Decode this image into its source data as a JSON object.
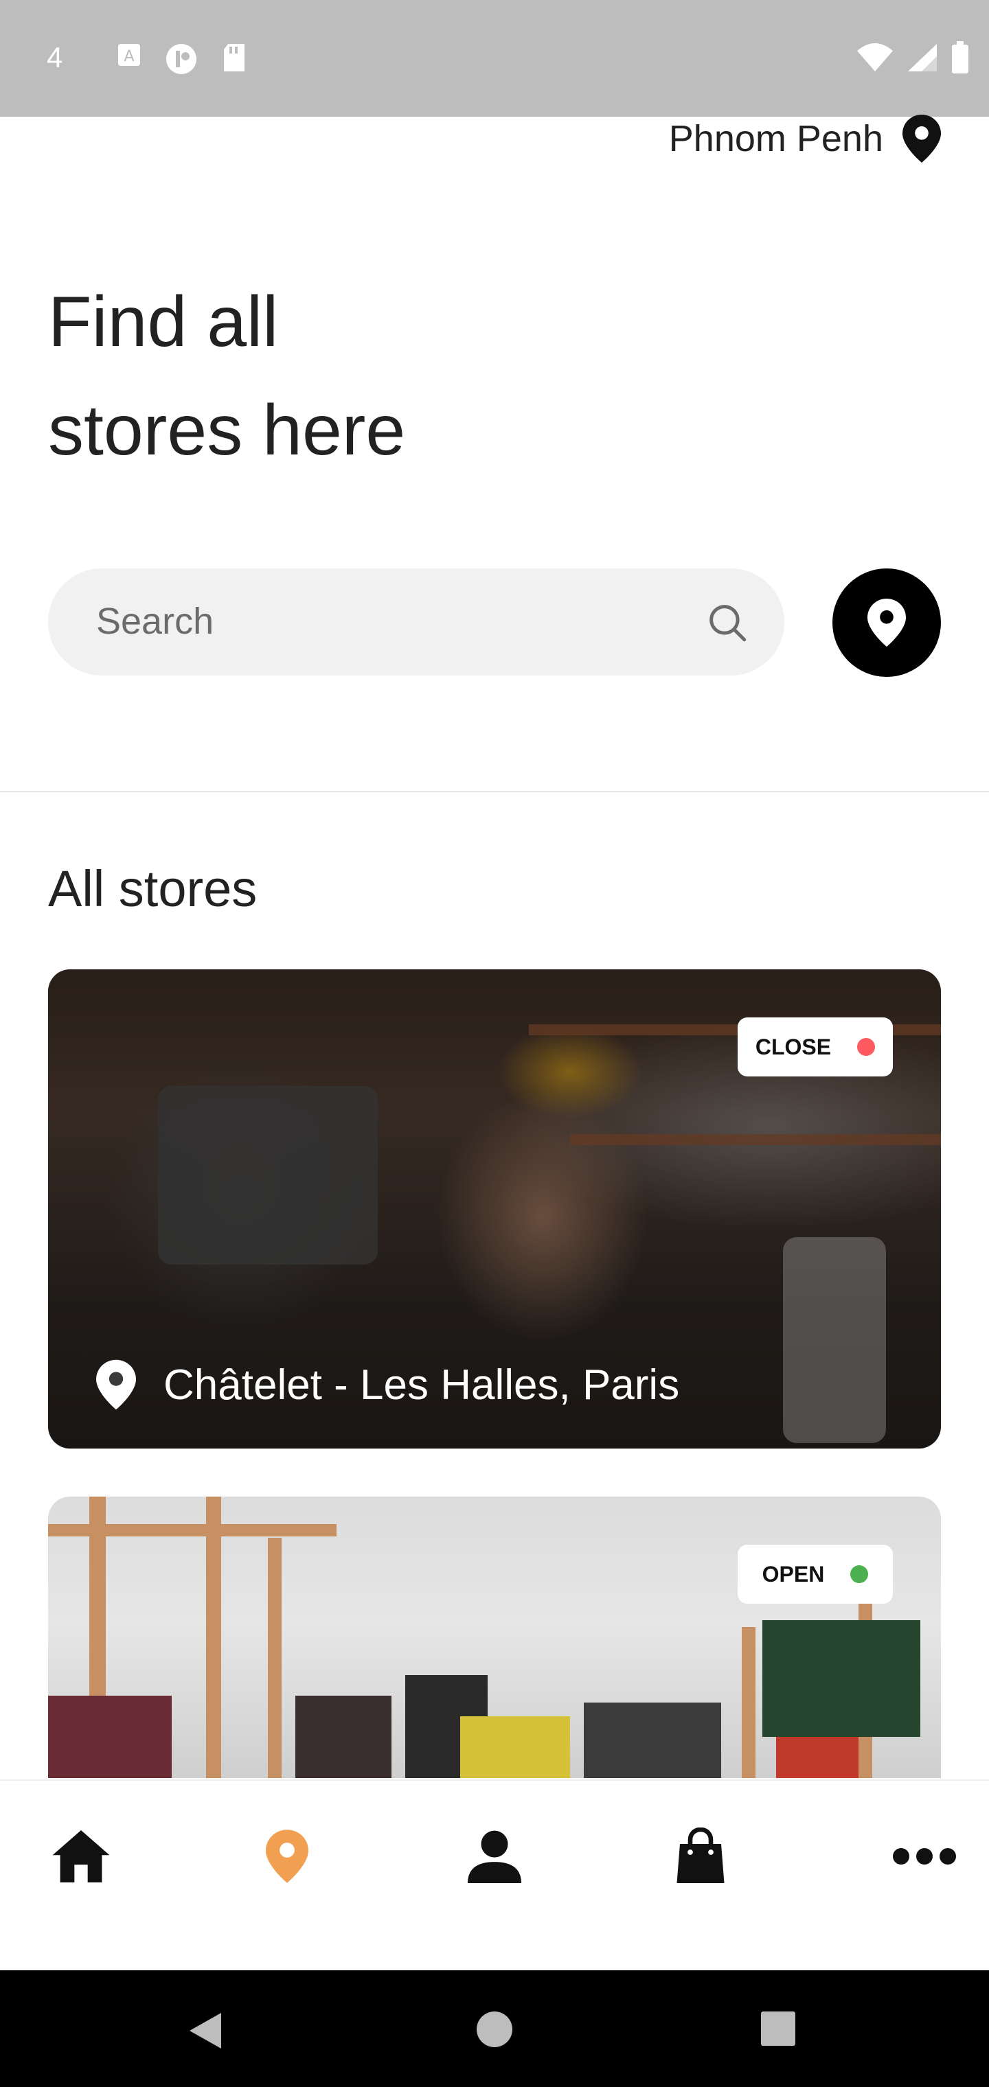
{
  "status_bar": {
    "time": "4",
    "icons": [
      "a-icon",
      "app-icon",
      "sd-card-icon",
      "wifi-icon",
      "signal-icon",
      "battery-icon"
    ]
  },
  "header": {
    "location_name": "Phnom Penh",
    "location_icon": "location-pin-icon"
  },
  "title": {
    "line1": "Find all",
    "line2": "stores here"
  },
  "search": {
    "placeholder": "Search"
  },
  "section_title": "All stores",
  "stores": [
    {
      "status": "CLOSE",
      "status_color": "#ff5a5f",
      "location": "Châtelet - Les Halles, Paris"
    },
    {
      "status": "OPEN",
      "status_color": "#4caf50",
      "location": ""
    }
  ],
  "bottom_nav": {
    "items": [
      "home-icon",
      "location-icon",
      "profile-icon",
      "bag-icon",
      "more-icon"
    ],
    "active_color": "#f0a050"
  }
}
